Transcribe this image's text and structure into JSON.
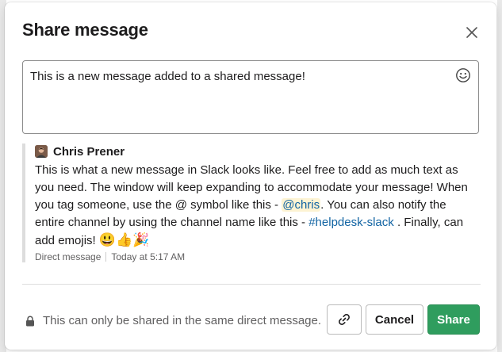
{
  "dialog": {
    "title": "Share message",
    "close_icon": "close-icon"
  },
  "composer": {
    "value": "This is a new message added to a shared message!",
    "emoji_icon": "smiley-icon"
  },
  "shared_message": {
    "author": "Chris Prener",
    "text_1": "This is what a new message in Slack looks like. Feel free to add as much text as you need. The window will keep expanding to accommodate your message! When you tag someone, use the  @ symbol like this - ",
    "mention": "@chris",
    "text_2": ". You can also notify the entire channel by using the channel name like this - ",
    "channel": "#helpdesk-slack",
    "text_3": " . Finally, can add emojis! ",
    "emojis": "😃👍🎉",
    "source": "Direct message",
    "timestamp": "Today at 5:17 AM"
  },
  "footer": {
    "notice": "This can only be shared in the same direct message.",
    "lock_icon": "lock-icon",
    "link_icon": "link-icon",
    "cancel_label": "Cancel",
    "share_label": "Share"
  },
  "colors": {
    "share_button": "#2f9d5e",
    "link": "#1264a3",
    "mention_bg": "#fdf3d3"
  }
}
